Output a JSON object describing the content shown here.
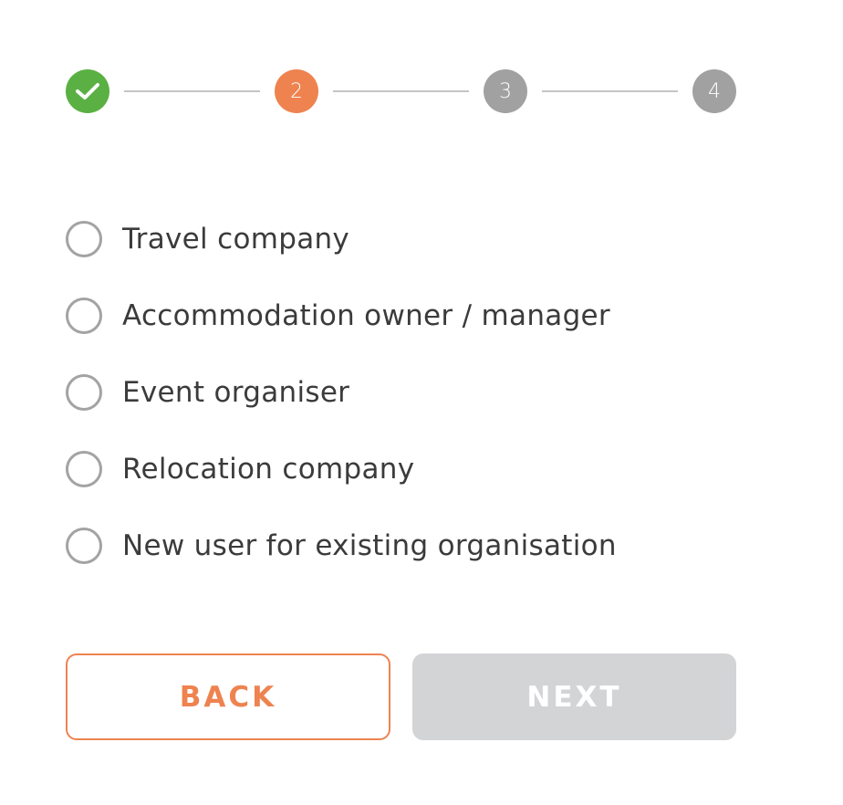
{
  "stepper": {
    "steps": [
      {
        "label": "",
        "state": "done",
        "icon": "check-icon"
      },
      {
        "label": "2",
        "state": "active"
      },
      {
        "label": "3",
        "state": "pending"
      },
      {
        "label": "4",
        "state": "pending"
      }
    ],
    "colors": {
      "done": "#5bb043",
      "active": "#ee8350",
      "pending": "#a1a1a1",
      "connector": "#c4c4c4"
    }
  },
  "options": [
    {
      "label": "Travel company",
      "selected": false
    },
    {
      "label": "Accommodation owner / manager",
      "selected": false
    },
    {
      "label": "Event organiser",
      "selected": false
    },
    {
      "label": "Relocation company",
      "selected": false
    },
    {
      "label": "New user for existing organisation",
      "selected": false
    }
  ],
  "buttons": {
    "back_label": "BACK",
    "next_label": "NEXT",
    "next_disabled": true,
    "accent_color": "#ee8350",
    "disabled_color": "#d3d4d6"
  }
}
